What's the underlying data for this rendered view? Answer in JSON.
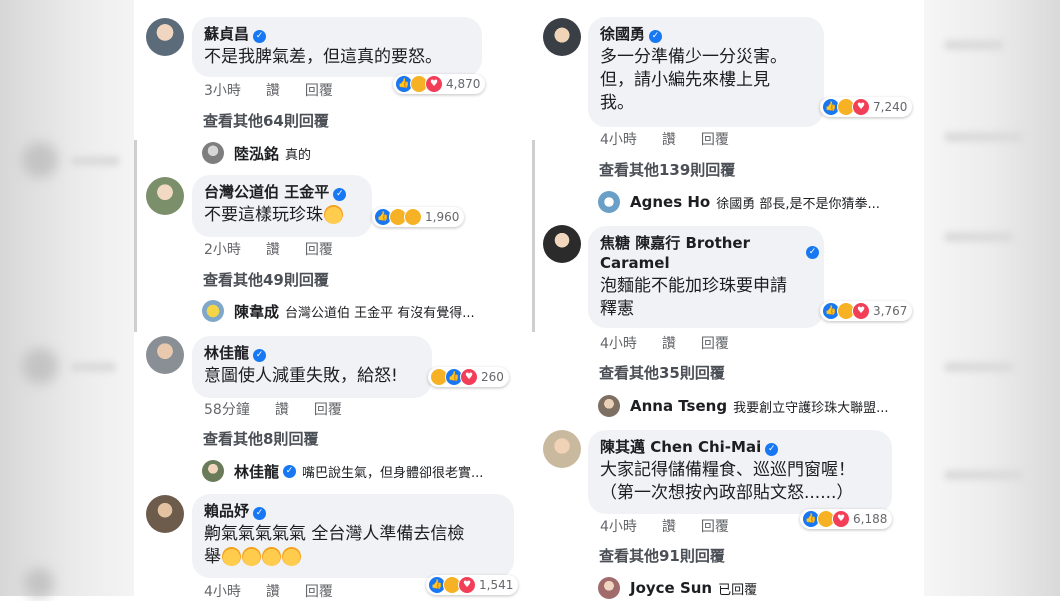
{
  "left_column": [
    {
      "name": "蘇貞昌",
      "verified": true,
      "text": "不是我脾氣差，但這真的要怒。",
      "time": "3小時",
      "like_label": "讚",
      "reply_label": "回覆",
      "reactions": [
        "like",
        "haha",
        "love"
      ],
      "reaction_count": "4,870",
      "more_replies": "查看其他64則回覆",
      "preview_name": "陸泓銘",
      "preview_text": "真的"
    },
    {
      "name": "台灣公道伯 王金平",
      "verified": true,
      "text": "不要這樣玩珍珠",
      "time": "2小時",
      "like_label": "讚",
      "reply_label": "回覆",
      "reactions": [
        "like",
        "haha",
        "wow"
      ],
      "reaction_count": "1,960",
      "more_replies": "查看其他49則回覆",
      "preview_name": "陳韋成",
      "preview_text": "台灣公道伯 王金平 有沒有覺得..."
    },
    {
      "name": "林佳龍",
      "verified": true,
      "text": "意圖使人減重失敗，給怒!",
      "time": "58分鐘",
      "like_label": "讚",
      "reply_label": "回覆",
      "reactions": [
        "haha",
        "like",
        "love"
      ],
      "reaction_count": "260",
      "more_replies": "查看其他8則回覆",
      "preview_name": "林佳龍",
      "preview_verified": true,
      "preview_text": "嘴巴說生氣，但身體卻很老實..."
    },
    {
      "name": "賴品妤",
      "verified": true,
      "text": "齁氣氣氣氣氣 全台灣人準備去信檢",
      "text2": "舉",
      "time": "4小時",
      "like_label": "讚",
      "reply_label": "回覆",
      "reactions": [
        "like",
        "haha",
        "love"
      ],
      "reaction_count": "1,541"
    }
  ],
  "right_column": [
    {
      "name": "徐國勇",
      "verified": true,
      "text": "多一分準備少一分災害。",
      "text2": "但，請小編先來樓上見",
      "text3": "我。",
      "time": "4小時",
      "like_label": "讚",
      "reply_label": "回覆",
      "reactions": [
        "like",
        "haha",
        "love"
      ],
      "reaction_count": "7,240",
      "more_replies": "查看其他139則回覆",
      "preview_name": "Agnes Ho",
      "preview_text": "徐國勇 部長,是不是你猜拳..."
    },
    {
      "name": "焦糖 陳嘉行 Brother",
      "name2": "Caramel",
      "verified": true,
      "text": "泡麵能不能加珍珠要申請",
      "text2": "釋憲",
      "time": "4小時",
      "like_label": "讚",
      "reply_label": "回覆",
      "reactions": [
        "like",
        "haha",
        "love"
      ],
      "reaction_count": "3,767",
      "more_replies": "查看其他35則回覆",
      "preview_name": "Anna Tseng",
      "preview_text": "我要創立守護珍珠大聯盟..."
    },
    {
      "name": "陳其邁 Chen Chi-Mai",
      "verified": true,
      "text": "大家記得儲備糧食、巡巡門窗喔！",
      "text2": "（第一次想按內政部貼文怒......）",
      "time": "4小時",
      "like_label": "讚",
      "reply_label": "回覆",
      "reactions": [
        "like",
        "haha",
        "love"
      ],
      "reaction_count": "6,188",
      "more_replies": "查看其他91則回覆",
      "preview_name": "Joyce Sun",
      "preview_text": "已回覆"
    }
  ],
  "colors": {
    "bubble": "#f0f2f5",
    "verified": "#1877f2",
    "meta": "#65676b"
  }
}
